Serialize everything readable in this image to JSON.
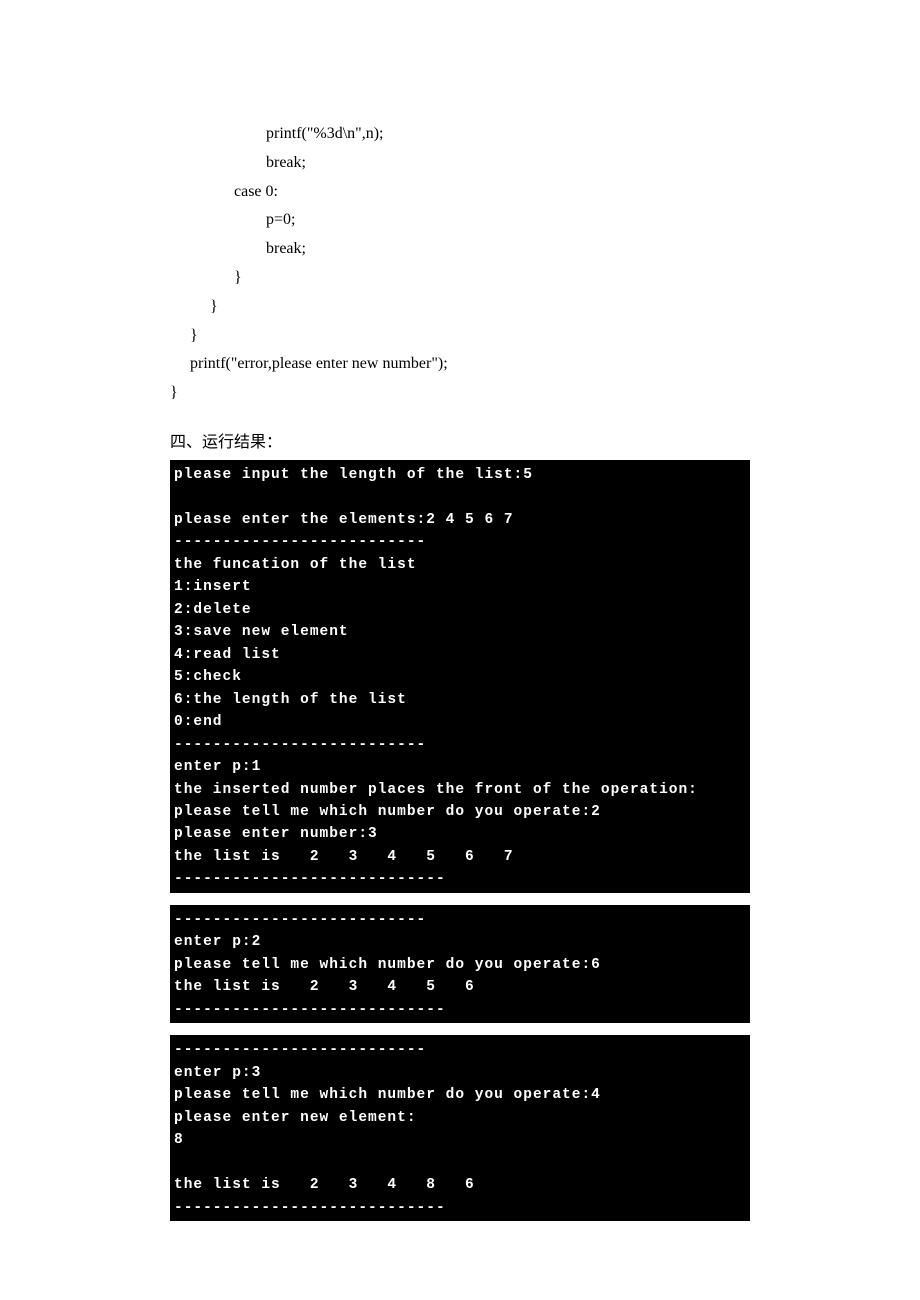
{
  "code_snippet": "                        printf(\"%3d\\n\",n);\n                        break;\n                case 0:\n                        p=0;\n                        break;\n                }\n          }\n     }\n     printf(\"error,please enter new number\");\n}",
  "section_heading": "四、运行结果：",
  "terminal": {
    "block1": "please input the length of the list:5\n\nplease enter the elements:2 4 5 6 7\n--------------------------\nthe funcation of the list\n1:insert\n2:delete\n3:save new element\n4:read list\n5:check\n6:the length of the list\n0:end\n--------------------------\nenter p:1\nthe inserted number places the front of the operation:\nplease tell me which number do you operate:2\nplease enter number:3\nthe list is   2   3   4   5   6   7\n----------------------------",
    "block2": "--------------------------\nenter p:2\nplease tell me which number do you operate:6\nthe list is   2   3   4   5   6\n----------------------------",
    "block3": "--------------------------\nenter p:3\nplease tell me which number do you operate:4\nplease enter new element:\n8\n\nthe list is   2   3   4   8   6\n----------------------------"
  }
}
